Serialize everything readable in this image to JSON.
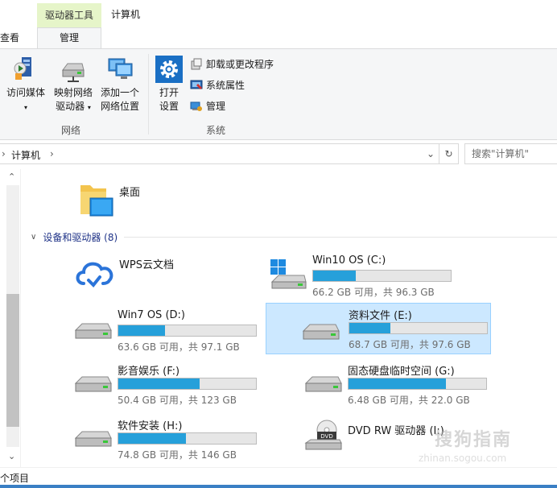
{
  "window": {
    "title": "计算机",
    "context_tab_header": "驱动器工具",
    "context_tab": "管理",
    "view_tab": "查看"
  },
  "ribbon": {
    "network": {
      "label": "网络",
      "access_media": "访问媒体",
      "map_drive_line1": "映射网络",
      "map_drive_line2": "驱动器",
      "add_location_line1": "添加一个",
      "add_location_line2": "网络位置"
    },
    "system": {
      "label": "系统",
      "open_settings_line1": "打开",
      "open_settings_line2": "设置",
      "uninstall": "卸载或更改程序",
      "properties": "系统属性",
      "manage": "管理"
    }
  },
  "address": {
    "crumb": "计算机",
    "search_placeholder": "搜索\"计算机\""
  },
  "content": {
    "folder_desktop": "桌面",
    "section_title": "设备和驱动器 (8)",
    "wps": "WPS云文档",
    "drives": [
      {
        "name": "Win10 OS (C:)",
        "size": "66.2 GB 可用，共 96.3 GB",
        "used_fraction": 0.31
      },
      {
        "name": "Win7 OS (D:)",
        "size": "63.6 GB 可用，共 97.1 GB",
        "used_fraction": 0.34
      },
      {
        "name": "资料文件 (E:)",
        "size": "68.7 GB 可用，共 97.6 GB",
        "used_fraction": 0.3
      },
      {
        "name": "影音娱乐 (F:)",
        "size": "50.4 GB 可用，共 123 GB",
        "used_fraction": 0.59
      },
      {
        "name": "固态硬盘临时空间 (G:)",
        "size": "6.48 GB 可用，共 22.0 GB",
        "used_fraction": 0.71
      },
      {
        "name": "软件安装 (H:)",
        "size": "74.8 GB 可用，共 146 GB",
        "used_fraction": 0.49
      }
    ],
    "dvd": "DVD RW 驱动器 (I:)",
    "dvd_label": "DVD"
  },
  "status": {
    "items": "个项目"
  },
  "watermark": {
    "main": "搜狗指南",
    "sub": "zhinan.sogou.com"
  },
  "colors": {
    "accent": "#26a0da",
    "selection": "#cce8ff",
    "context_tab": "#e6f5c9"
  }
}
